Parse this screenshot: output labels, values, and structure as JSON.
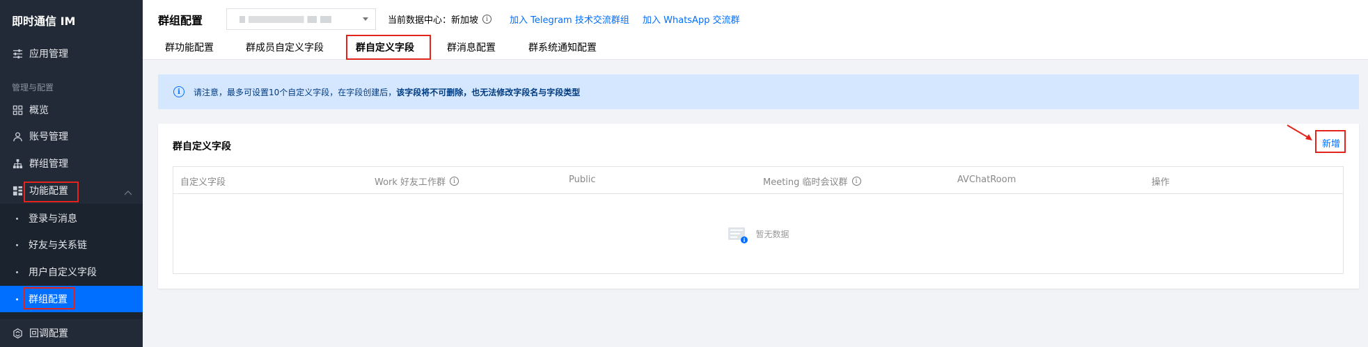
{
  "sidebar": {
    "title": "即时通信 IM",
    "items": [
      {
        "label": "应用管理",
        "icon": "sliders-icon"
      },
      {
        "label": "概览",
        "icon": "grid-icon"
      },
      {
        "label": "账号管理",
        "icon": "user-icon"
      },
      {
        "label": "群组管理",
        "icon": "org-icon"
      },
      {
        "label": "功能配置",
        "icon": "function-config-icon"
      },
      {
        "label": "回调配置",
        "icon": "callback-icon"
      }
    ],
    "section_label": "管理与配置",
    "sub_items": [
      {
        "label": "登录与消息"
      },
      {
        "label": "好友与关系链"
      },
      {
        "label": "用户自定义字段"
      },
      {
        "label": "群组配置",
        "active": true
      }
    ]
  },
  "header": {
    "title": "群组配置",
    "datacenter_label": "当前数据中心：新加坡",
    "links": [
      "加入 Telegram 技术交流群组",
      "加入 WhatsApp 交流群"
    ]
  },
  "tabs": [
    "群功能配置",
    "群成员自定义字段",
    "群自定义字段",
    "群消息配置",
    "群系统通知配置"
  ],
  "active_tab": "群自定义字段",
  "notice": {
    "prefix": "请注意，最多可设置10个自定义字段，在字段创建后，",
    "emphasis": "该字段将不可删除，也无法修改字段名与字段类型"
  },
  "card": {
    "title": "群自定义字段",
    "add_label": "新增",
    "columns": [
      "自定义字段",
      "Work 好友工作群",
      "Public",
      "Meeting 临时会议群",
      "AVChatRoom",
      "操作"
    ],
    "empty_text": "暂无数据"
  },
  "colors": {
    "accent": "#006eff",
    "sidebar_bg": "#212a36",
    "highlight": "#e2241c",
    "notice_bg": "#d5e7ff"
  }
}
